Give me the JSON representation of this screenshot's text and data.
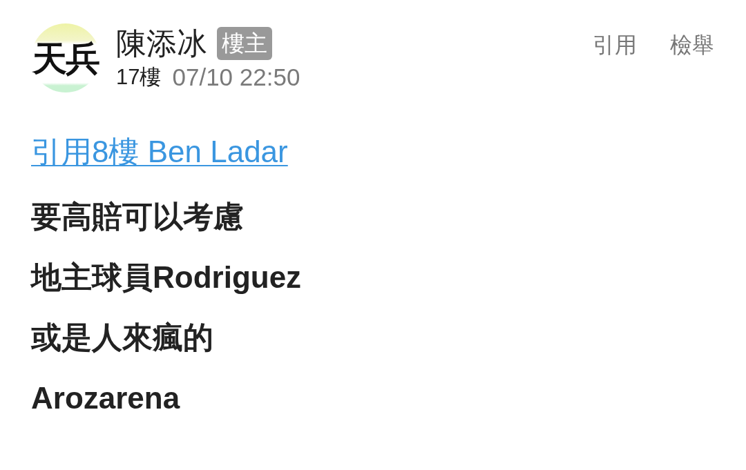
{
  "post": {
    "avatar": {
      "text": "天兵"
    },
    "author": "陳添冰",
    "badge": "樓主",
    "floor": "17樓",
    "time": "07/10 22:50",
    "actions": [
      "引用",
      "檢舉"
    ],
    "quote_link": "引用8樓 Ben Ladar",
    "lines": [
      "要高賠可以考慮",
      "地主球員Rodriguez",
      "或是人來瘋的",
      "Arozarena"
    ]
  }
}
